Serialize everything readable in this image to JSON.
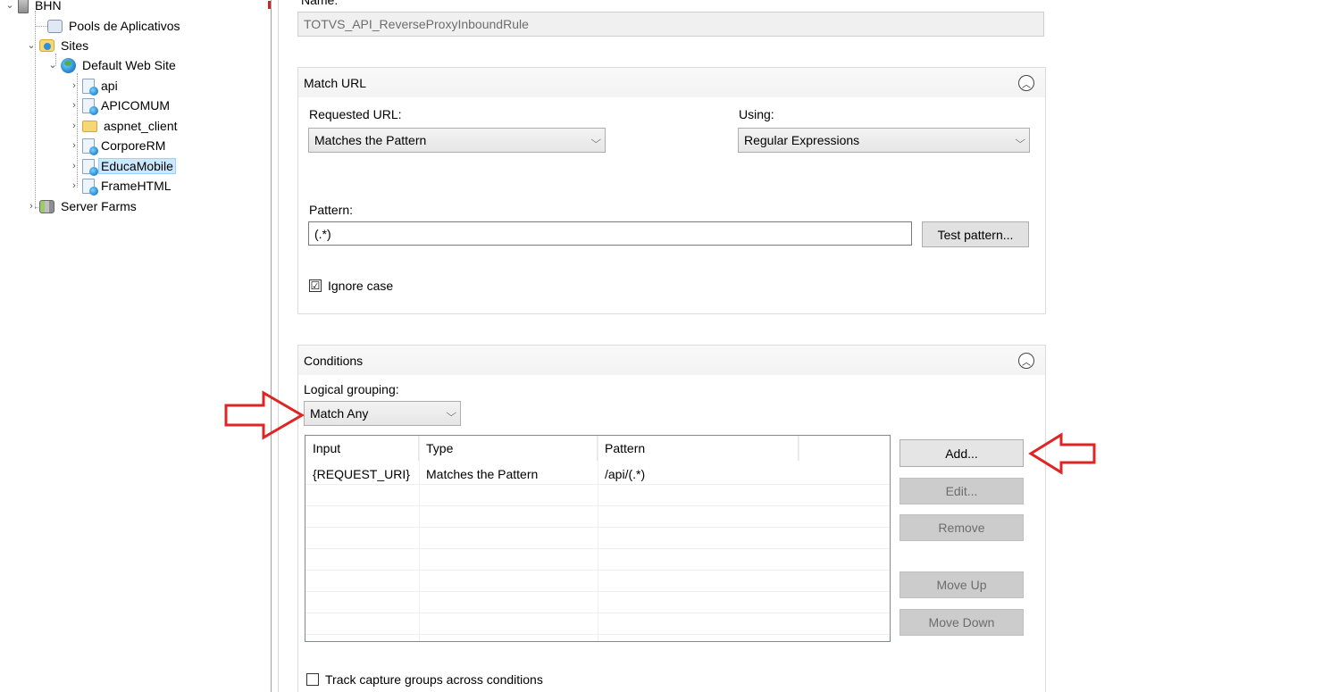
{
  "tree": {
    "items": [
      {
        "label": "BHN",
        "icon": "server-icon"
      },
      {
        "label": "Pools de Aplicativos",
        "icon": "app-pool-icon"
      },
      {
        "label": "Sites",
        "icon": "sites-folder-icon"
      },
      {
        "label": "Default Web Site",
        "icon": "globe-icon"
      },
      {
        "label": "api",
        "icon": "web-app-icon"
      },
      {
        "label": "APICOMUM",
        "icon": "web-app-icon"
      },
      {
        "label": "aspnet_client",
        "icon": "folder-icon"
      },
      {
        "label": "CorporeRM",
        "icon": "web-app-icon"
      },
      {
        "label": "EducaMobile",
        "icon": "web-app-icon"
      },
      {
        "label": "FrameHTML",
        "icon": "web-app-icon"
      },
      {
        "label": "Server Farms",
        "icon": "server-farm-icon"
      }
    ]
  },
  "form": {
    "name_label": "Name:",
    "name_value": "TOTVS_API_ReverseProxyInboundRule"
  },
  "match_url": {
    "title": "Match URL",
    "requested_url_label": "Requested URL:",
    "requested_url_value": "Matches the Pattern",
    "using_label": "Using:",
    "using_value": "Regular Expressions",
    "pattern_label": "Pattern:",
    "pattern_value": "(.*)",
    "test_pattern_button": "Test pattern...",
    "ignore_case_label": "Ignore case",
    "ignore_case_checked": "☑"
  },
  "conditions": {
    "title": "Conditions",
    "logical_grouping_label": "Logical grouping:",
    "logical_grouping_value": "Match Any",
    "columns": [
      "Input",
      "Type",
      "Pattern"
    ],
    "rows": [
      {
        "input": "{REQUEST_URI}",
        "type": "Matches the Pattern",
        "pattern": "/api/(.*)"
      }
    ],
    "buttons": {
      "add": "Add...",
      "edit": "Edit...",
      "remove": "Remove",
      "move_up": "Move Up",
      "move_down": "Move Down"
    },
    "track_capture_label": "Track capture groups across conditions"
  },
  "colors": {
    "annotation_arrow": "#e02424"
  }
}
